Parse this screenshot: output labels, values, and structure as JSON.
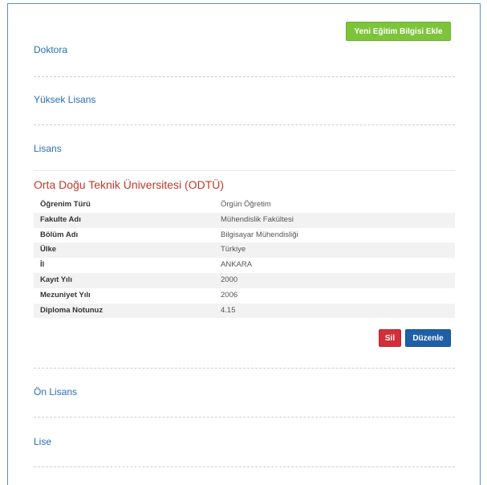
{
  "actions": {
    "add_education_label": "Yeni Eğitim Bilgisi Ekle",
    "delete_label": "Sil",
    "edit_label": "Düzenle"
  },
  "sections": {
    "doctorate": "Doktora",
    "masters": "Yüksek Lisans",
    "bachelors": "Lisans",
    "associate": "Ön Lisans",
    "high_school": "Lise"
  },
  "education": {
    "school_name": "Orta Doğu Teknik Üniversitesi (ODTÜ)",
    "rows": [
      {
        "label": "Öğrenim Türü",
        "value": "Örgün Öğretim"
      },
      {
        "label": "Fakulte Adı",
        "value": "Mühendislik Fakültesi"
      },
      {
        "label": "Bölüm Adı",
        "value": "Bilgisayar Mühendisliği"
      },
      {
        "label": "Ülke",
        "value": "Türkiye"
      },
      {
        "label": "İl",
        "value": "ANKARA"
      },
      {
        "label": "Kayıt Yılı",
        "value": "2000"
      },
      {
        "label": "Mezuniyet Yılı",
        "value": "2006"
      },
      {
        "label": "Diploma Notunuz",
        "value": "4.15"
      }
    ]
  },
  "colors": {
    "add_button": "#7dc43a",
    "delete_button": "#d0303a",
    "edit_button": "#1f5fa8",
    "section_title": "#2a6fb4",
    "school_title": "#c0392b"
  }
}
